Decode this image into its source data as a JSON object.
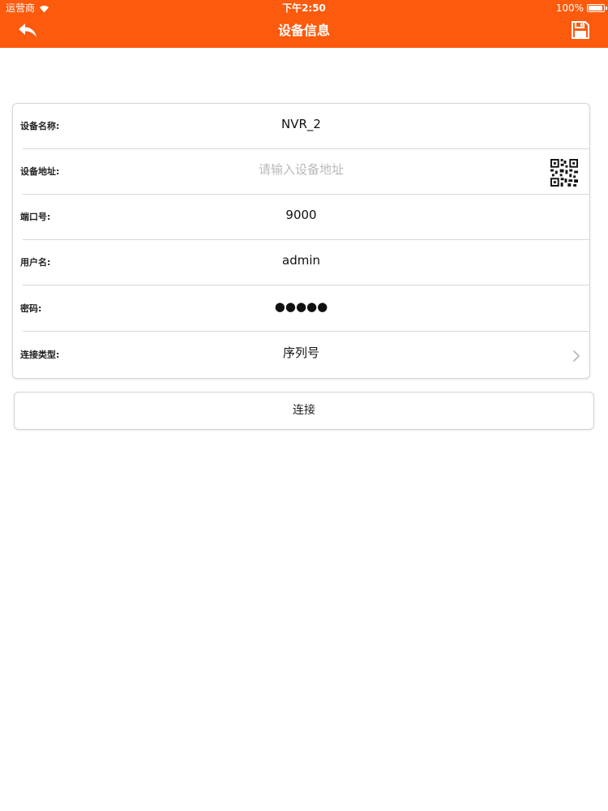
{
  "status_bar": {
    "carrier": "运营商",
    "time": "下午2:50",
    "battery": "100%",
    "battery_level": 1.0
  },
  "nav": {
    "title": "设备信息",
    "back_icon": "back-arrow-icon",
    "save_icon": "save-disk-icon"
  },
  "form": {
    "rows": [
      {
        "label": "设备名称:",
        "value": "NVR_2",
        "placeholder": ""
      },
      {
        "label": "设备地址:",
        "value": "",
        "placeholder": "请输入设备地址"
      },
      {
        "label": "端口号:",
        "value": "9000",
        "placeholder": ""
      },
      {
        "label": "用户名:",
        "value": "admin",
        "placeholder": ""
      },
      {
        "label": "密码:",
        "value": "●●●●●",
        "placeholder": ""
      },
      {
        "label": "连接类型:",
        "value": "序列号",
        "placeholder": ""
      }
    ]
  },
  "connect_button": {
    "label": "连接"
  },
  "colors": {
    "header": "#fc5a0d",
    "divider": "#d9d9d9",
    "placeholder": "#b9b9b9"
  }
}
